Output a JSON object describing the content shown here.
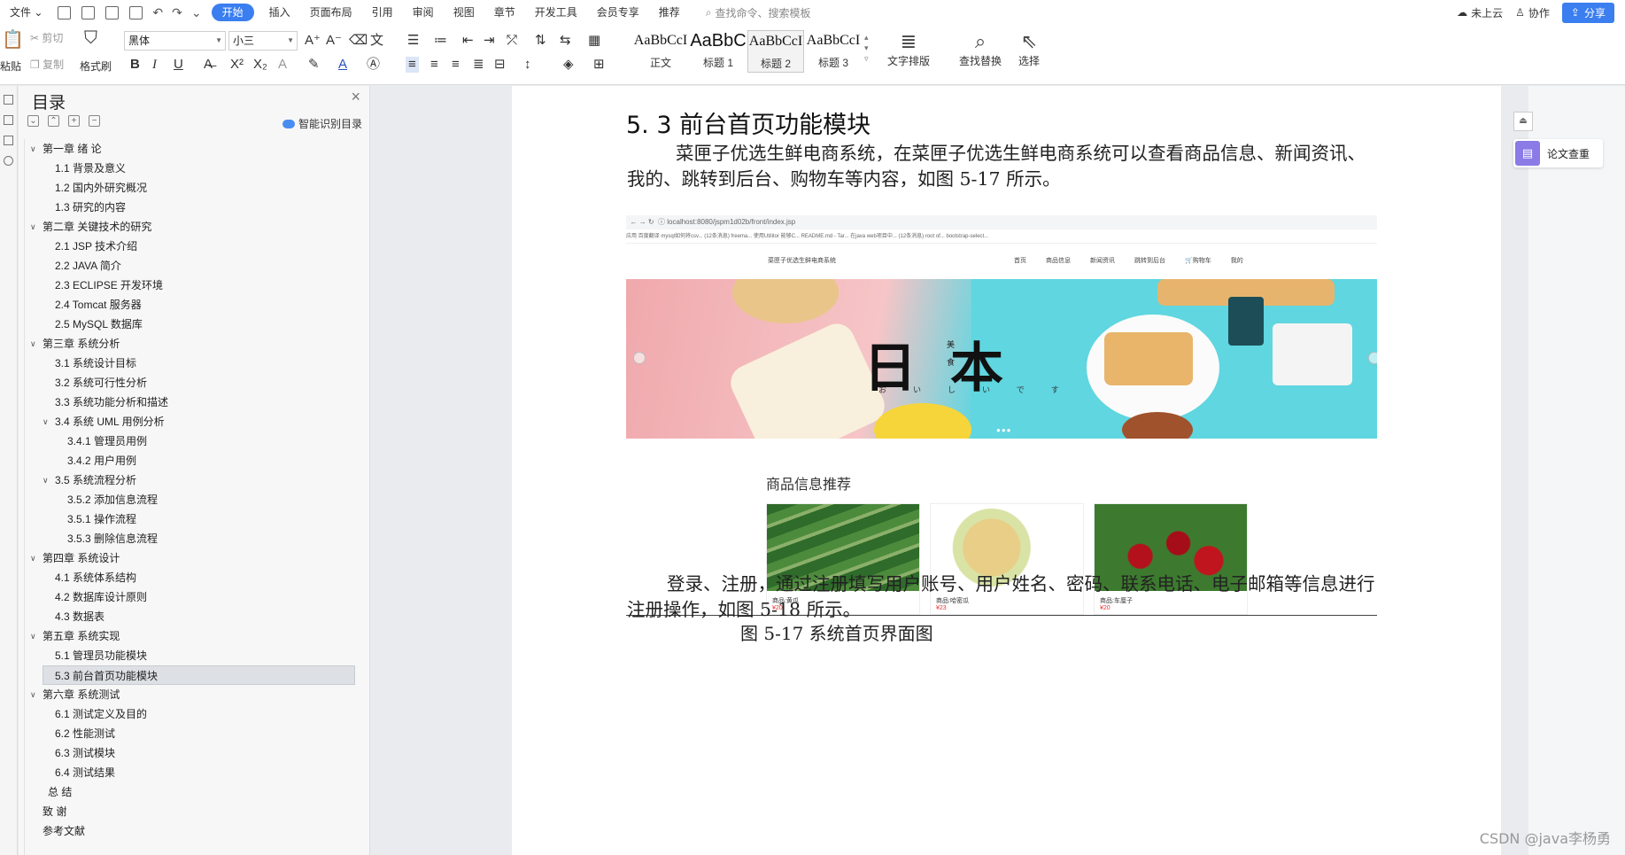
{
  "menubar": {
    "file": "文件",
    "tabs": [
      "开始",
      "插入",
      "页面布局",
      "引用",
      "审阅",
      "视图",
      "章节",
      "开发工具",
      "会员专享",
      "推荐"
    ],
    "active_tab": "开始",
    "search_placeholder": "查找命令、搜索模板",
    "cloud": "未上云",
    "collab": "协作",
    "share": "分享"
  },
  "ribbon": {
    "paste": "粘贴",
    "cut": "剪切",
    "copy": "复制",
    "format_painter": "格式刷",
    "font_name": "黑体",
    "font_size": "小三",
    "styles": [
      {
        "sample": "AaBbCcI",
        "label": "正文"
      },
      {
        "sample": "AaBbC",
        "label": "标题 1"
      },
      {
        "sample": "AaBbCcI",
        "label": "标题 2"
      },
      {
        "sample": "AaBbCcI",
        "label": "标题 3"
      }
    ],
    "text_layout": "文字排版",
    "find_replace": "查找替换",
    "select": "选择"
  },
  "toc": {
    "title": "目录",
    "smart": "智能识别目录",
    "items": [
      {
        "text": "第一章  绪  论",
        "level": 1,
        "arrow": true
      },
      {
        "text": "1.1 背景及意义",
        "level": 2
      },
      {
        "text": "1.2 国内外研究概况",
        "level": 2
      },
      {
        "text": "1.3  研究的内容",
        "level": 2
      },
      {
        "text": "第二章  关键技术的研究",
        "level": 1,
        "arrow": true
      },
      {
        "text": "2.1 JSP 技术介绍",
        "level": 2
      },
      {
        "text": "2.2 JAVA 简介",
        "level": 2
      },
      {
        "text": "2.3 ECLIPSE  开发环境",
        "level": 2
      },
      {
        "text": "2.4 Tomcat 服务器",
        "level": 2
      },
      {
        "text": "2.5 MySQL 数据库",
        "level": 2
      },
      {
        "text": "第三章  系统分析",
        "level": 1,
        "arrow": true
      },
      {
        "text": "3.1  系统设计目标",
        "level": 2
      },
      {
        "text": "3.2  系统可行性分析",
        "level": 2
      },
      {
        "text": "3.3  系统功能分析和描述",
        "level": 2
      },
      {
        "text": "3.4 系统 UML 用例分析",
        "level": 2,
        "arrow": true
      },
      {
        "text": "3.4.1 管理员用例",
        "level": 3
      },
      {
        "text": "3.4.2 用户用例",
        "level": 3
      },
      {
        "text": "3.5 系统流程分析",
        "level": 2,
        "arrow": true
      },
      {
        "text": "3.5.2 添加信息流程",
        "level": 3
      },
      {
        "text": "3.5.1 操作流程",
        "level": 3
      },
      {
        "text": "3.5.3 删除信息流程",
        "level": 3
      },
      {
        "text": "第四章  系统设计",
        "level": 1,
        "arrow": true
      },
      {
        "text": "4.1  系统体系结构",
        "level": 2
      },
      {
        "text": "4.2  数据库设计原则",
        "level": 2
      },
      {
        "text": "4.3  数据表",
        "level": 2
      },
      {
        "text": "第五章  系统实现",
        "level": 1,
        "arrow": true
      },
      {
        "text": "5.1 管理员功能模块",
        "level": 2
      },
      {
        "text": "5.3 前台首页功能模块",
        "level": 2,
        "selected": true
      },
      {
        "text": "第六章    系统测试",
        "level": 1,
        "arrow": true
      },
      {
        "text": "6.1 测试定义及目的",
        "level": 2
      },
      {
        "text": "6.2 性能测试",
        "level": 2
      },
      {
        "text": "6.3 测试模块",
        "level": 2
      },
      {
        "text": "6.4 测试结果",
        "level": 2
      },
      {
        "text": "总    结",
        "level": 1.5
      },
      {
        "text": "致    谢",
        "level": 1
      },
      {
        "text": "参考文献",
        "level": 1
      }
    ]
  },
  "doc": {
    "heading": "5. 3 前台首页功能模块",
    "para1": "菜匣子优选生鲜电商系统，在菜匣子优选生鲜电商系统可以查看商品信息、新闻资讯、我的、跳转到后台、购物车等内容，如图 5-17 所示。",
    "caption": "图 5-17 系统首页界面图",
    "para2": "登录、注册，通过注册填写用户账号、用户姓名、密码、联系电话、电子邮箱等信息进行注册操作，如图 5-18 所示。"
  },
  "screenshot": {
    "url": "localhost:8080/jspm1d02b/front/index.jsp",
    "bookmarks": "应用   百度翻译   mysql如何将csv...   (12条消息) freema...   使用Utilitor 能够C...   README.md - Tar...   在java web项目中...   (12条消息) root of...   bootstrap-select...",
    "brand": "菜匣子优选生鲜电商系统",
    "nav_links": [
      "首页",
      "商品信息",
      "新闻资讯",
      "跳转到后台",
      "购物车",
      "我的"
    ],
    "banner_title": "日本",
    "banner_sub": "おいしいです",
    "banner_kanji": "美食",
    "rec_title": "商品信息推荐",
    "products": [
      {
        "name": "商品:黄瓜",
        "price": "¥20"
      },
      {
        "name": "商品:哈密瓜",
        "price": "¥23"
      },
      {
        "name": "商品:车厘子",
        "price": "¥20"
      }
    ]
  },
  "rightpanel": {
    "paper_check": "论文查重"
  },
  "watermark": "CSDN @java李杨勇"
}
